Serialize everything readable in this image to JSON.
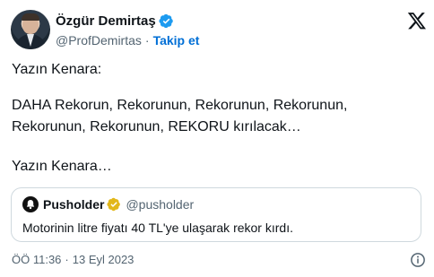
{
  "author": {
    "display_name": "Özgür Demirtaş",
    "handle": "@ProfDemirtas",
    "separator": "·",
    "follow_label": "Takip et",
    "verified": true
  },
  "tweet": {
    "line1": "Yazın Kenara:",
    "line2": "DAHA Rekorun, Rekorunun, Rekorunun, Rekorunun,",
    "line3": "Rekorunun, Rekorunun, REKORU kırılacak…",
    "line4": "Yazın Kenara…"
  },
  "quoted": {
    "display_name": "Pusholder",
    "handle": "@pusholder",
    "text": "Motorinin litre fiyatı 40 TL'ye ulaşarak rekor kırdı.",
    "badge": "gold-verified"
  },
  "meta": {
    "time": "ÖÖ 11:36",
    "separator": "·",
    "date": "13 Eyl 2023"
  },
  "icons": {
    "logo": "x-logo-icon",
    "info": "info-icon"
  },
  "colors": {
    "link": "#006fd6",
    "verified_blue": "#1d9bf0",
    "gold_badge": "#e2b719",
    "muted_text": "#536471",
    "border": "#cfd9de"
  }
}
